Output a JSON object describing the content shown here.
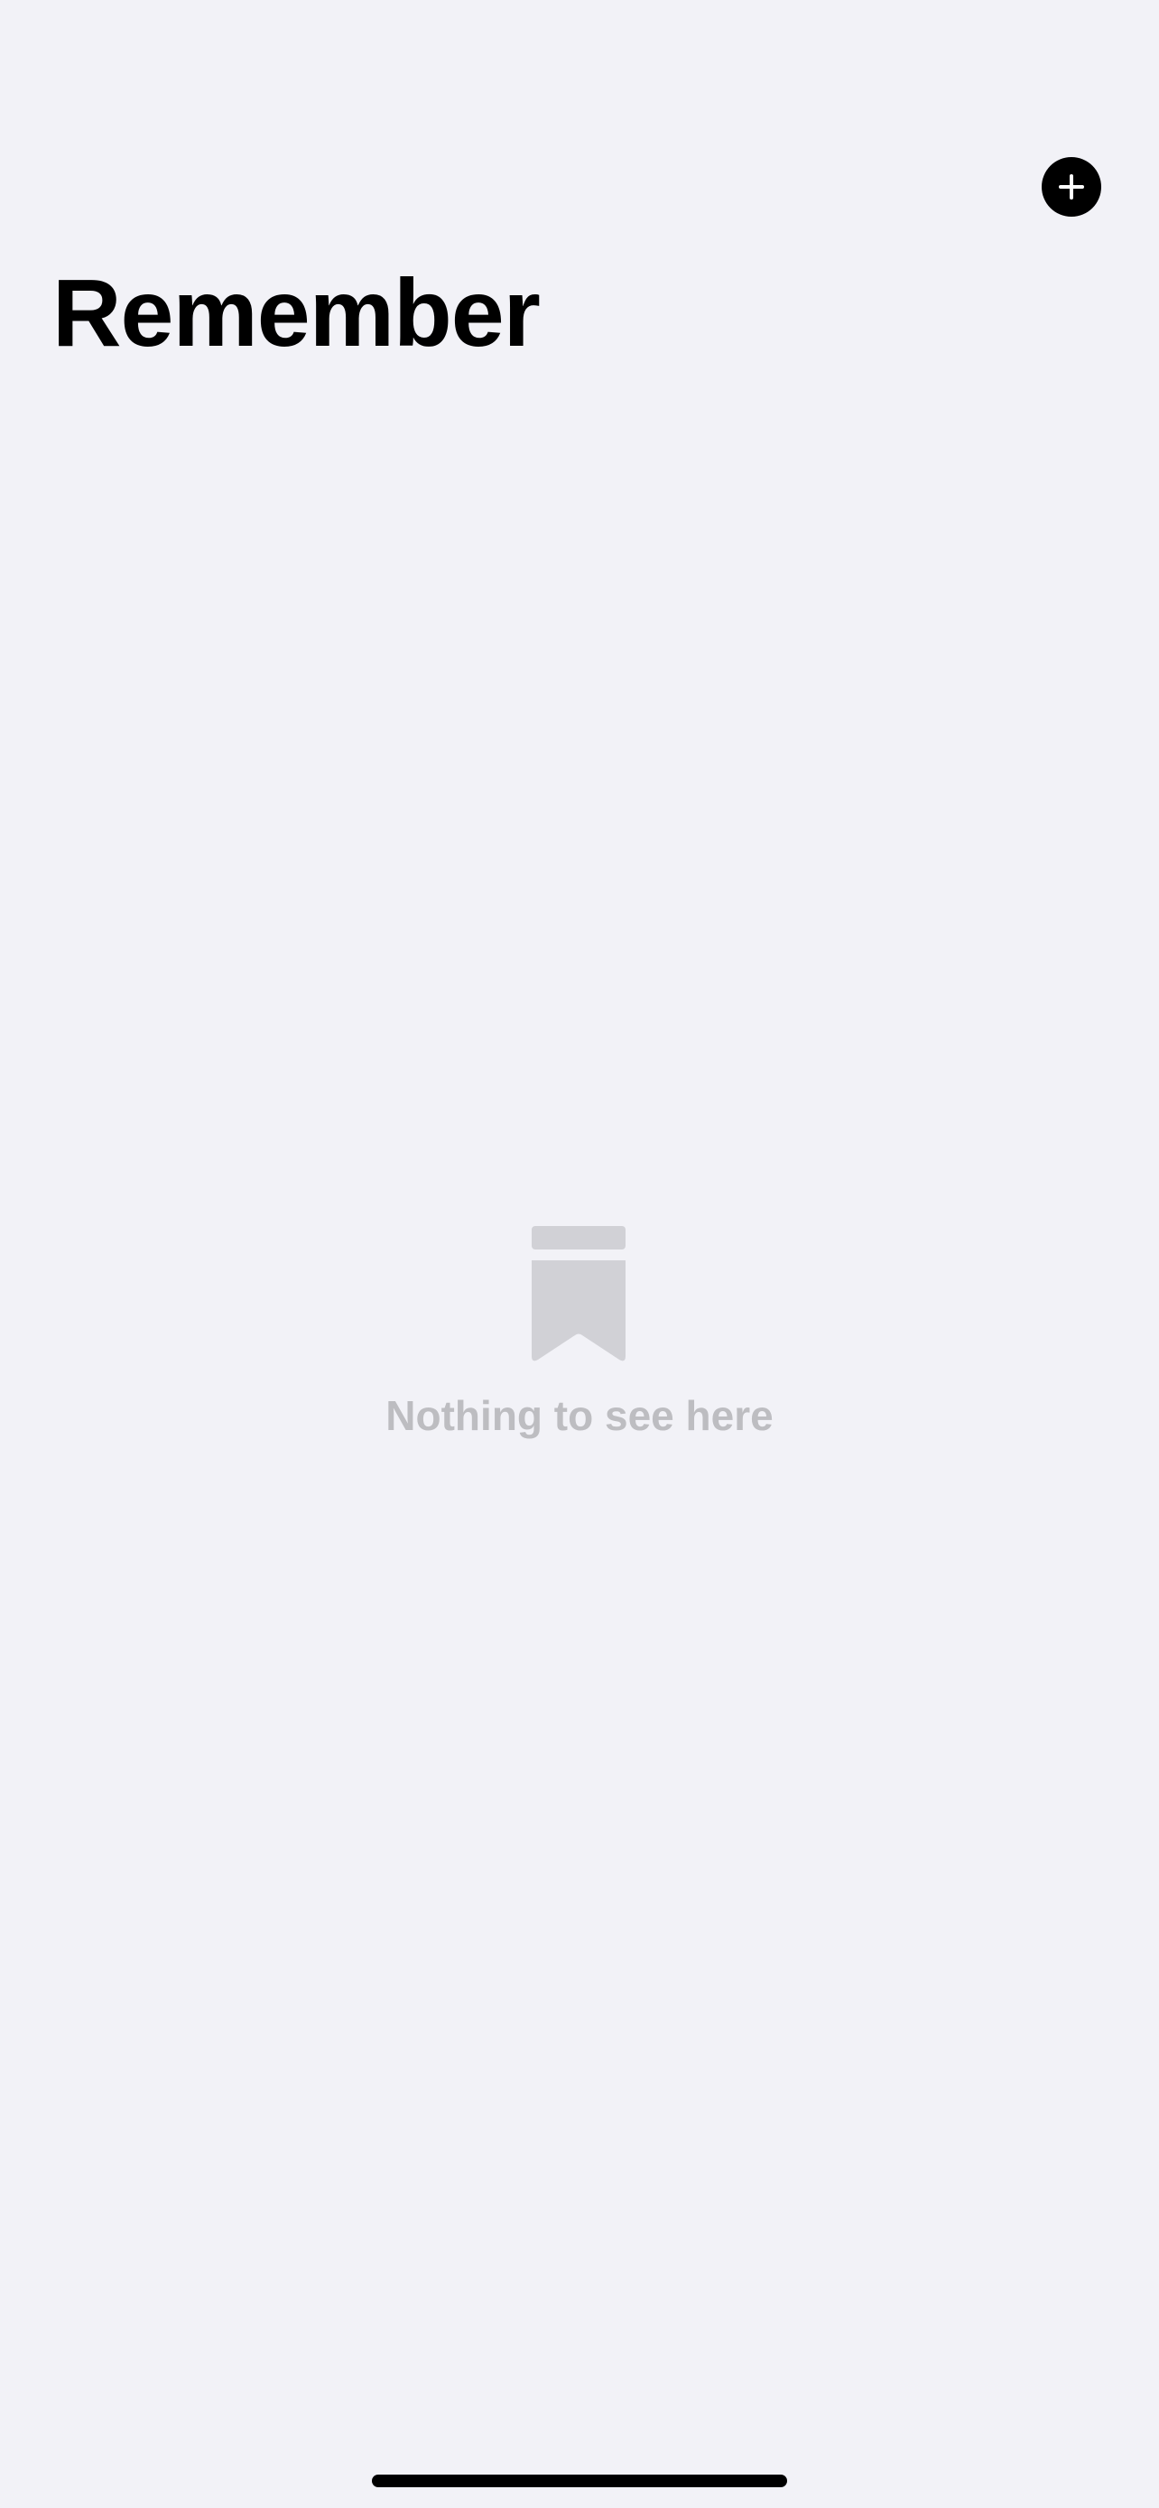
{
  "header": {
    "title": "Remember",
    "add_button_icon": "plus-circle-icon"
  },
  "empty_state": {
    "icon": "bookmark-icon",
    "message": "Nothing to see here"
  },
  "colors": {
    "background": "#F2F2F7",
    "title": "#000000",
    "add_button": "#000000",
    "empty_icon": "#D1D1D6",
    "empty_text": "#BDBDC1",
    "home_indicator": "#000000"
  }
}
